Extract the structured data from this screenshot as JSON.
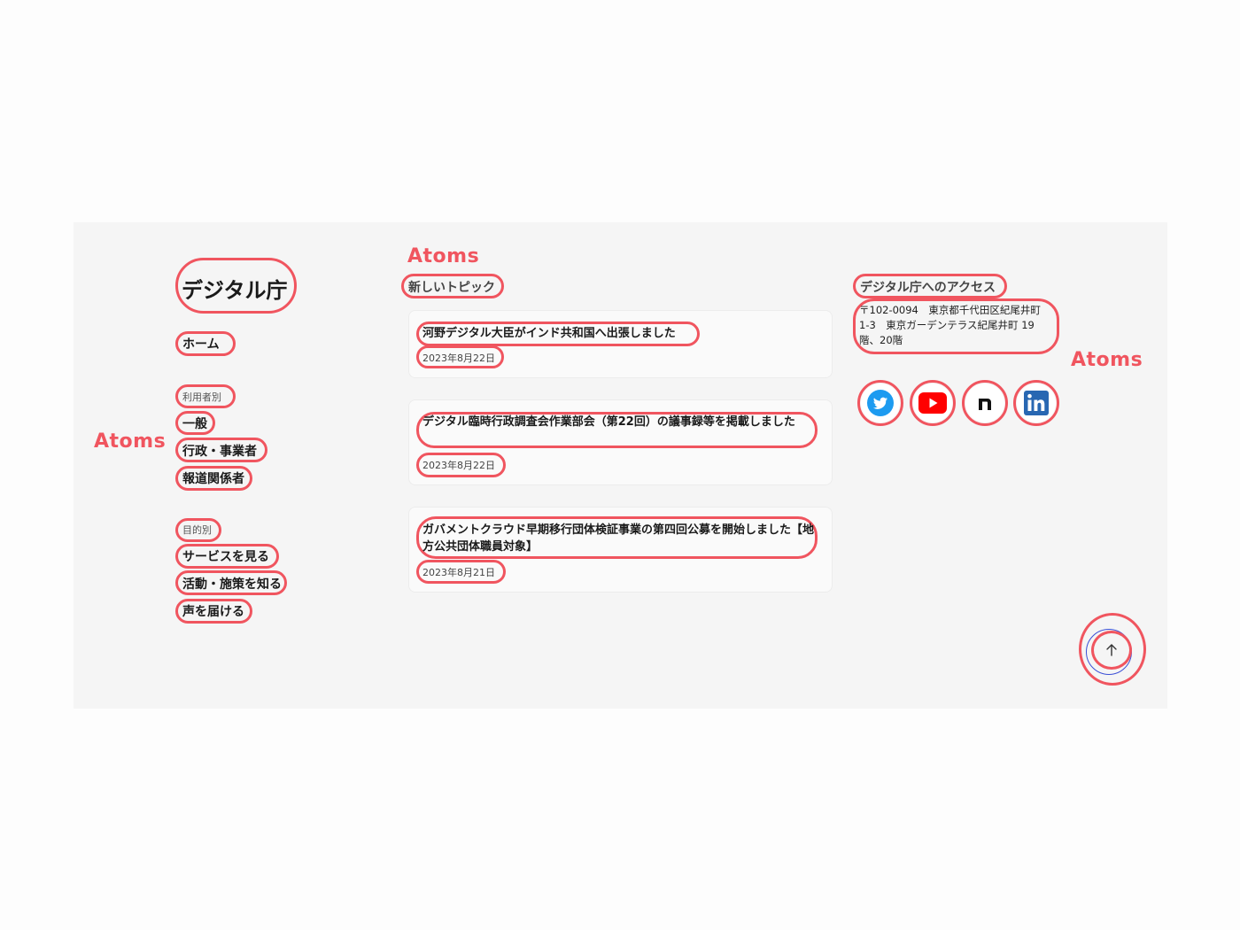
{
  "annotation": {
    "label": "Atoms",
    "color": "#f0555f"
  },
  "logo": {
    "text": "デジタル庁"
  },
  "nav": {
    "home": "ホーム",
    "by_user": {
      "heading": "利用者別",
      "items": [
        "一般",
        "行政・事業者",
        "報道関係者"
      ]
    },
    "by_purpose": {
      "heading": "目的別",
      "items": [
        "サービスを見る",
        "活動・施策を知る",
        "声を届ける"
      ]
    }
  },
  "topics": {
    "heading": "新しいトピック",
    "items": [
      {
        "title": "河野デジタル大臣がインド共和国へ出張しました",
        "date": "2023年8月22日"
      },
      {
        "title": "デジタル臨時行政調査会作業部会（第22回）の議事録等を掲載しました",
        "date": "2023年8月22日"
      },
      {
        "title": "ガバメントクラウド早期移行団体検証事業の第四回公募を開始しました【地方公共団体職員対象】",
        "date": "2023年8月21日"
      }
    ]
  },
  "access": {
    "heading": "デジタル庁へのアクセス",
    "address": "〒102-0094　東京都千代田区紀尾井町1-3　東京ガーデンテラス紀尾井町 19階、20階"
  },
  "social": [
    {
      "name": "twitter-icon",
      "color": "#1d9bf0"
    },
    {
      "name": "youtube-icon",
      "color": "#ff0000"
    },
    {
      "name": "note-icon",
      "color": "#111111"
    },
    {
      "name": "linkedin-icon",
      "color": "#2867b2"
    }
  ],
  "back_to_top": {
    "icon": "arrow-up-icon"
  }
}
